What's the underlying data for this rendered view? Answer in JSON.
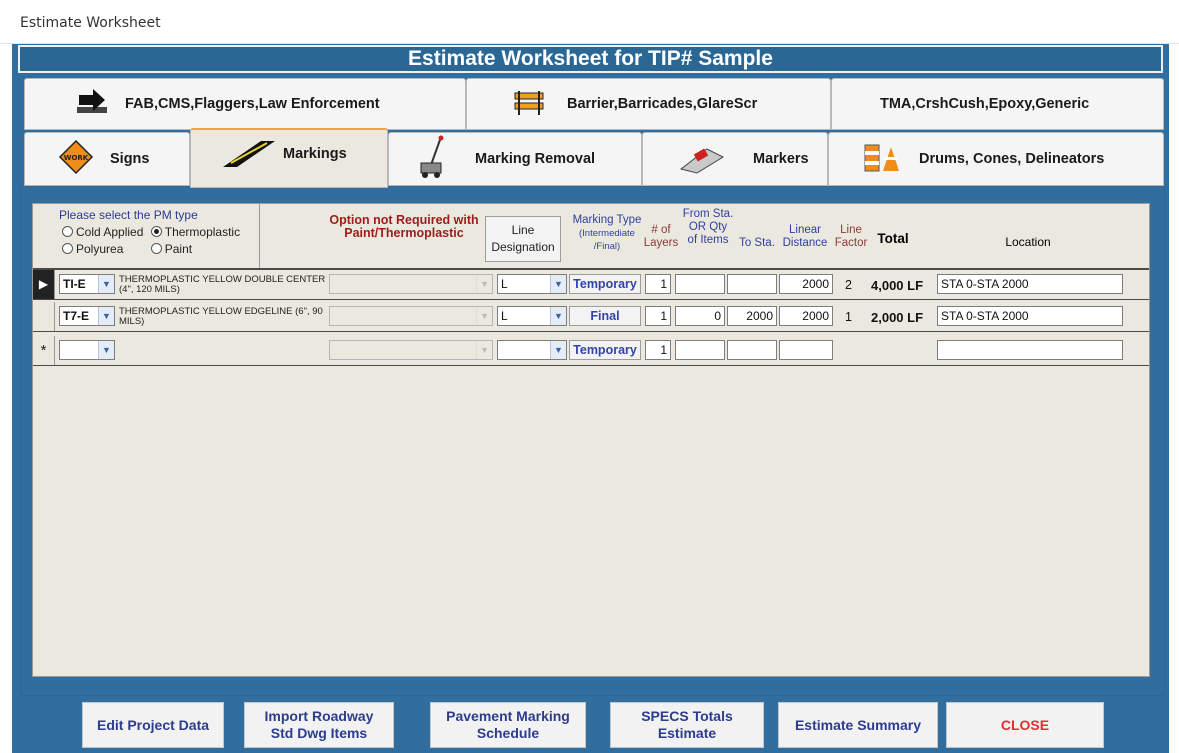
{
  "window": {
    "title": "Estimate Worksheet"
  },
  "header": {
    "title": "Estimate Worksheet for TIP# Sample"
  },
  "tabs_row1": [
    {
      "label": "FAB,CMS,Flaggers,Law Enforcement",
      "icon": "arrow-sign-icon"
    },
    {
      "label": "Barrier,Barricades,GlareScr",
      "icon": "barricade-icon"
    },
    {
      "label": "TMA,CrshCush,Epoxy,Generic",
      "icon": ""
    }
  ],
  "tabs_row2": [
    {
      "label": "Signs",
      "icon": "work-zone-sign-icon",
      "active": false
    },
    {
      "label": "Markings",
      "icon": "road-marking-icon",
      "active": true
    },
    {
      "label": "Marking Removal",
      "icon": "grinder-icon",
      "active": false
    },
    {
      "label": "Markers",
      "icon": "pavement-marker-icon",
      "active": false
    },
    {
      "label": "Drums, Cones, Delineators",
      "icon": "traffic-cone-icon",
      "active": false
    }
  ],
  "pm_type": {
    "title": "Please select the PM type",
    "options": [
      "Cold Applied",
      "Thermoplastic",
      "Polyurea",
      "Paint"
    ],
    "selected": "Thermoplastic"
  },
  "columns": {
    "option": "Option not Required with Paint/Thermoplastic",
    "line_designation": "Line Designation",
    "marking_type_1": "Marking Type",
    "marking_type_2": "(Intermediate /Final)",
    "layers_1": "# of",
    "layers_2": "Layers",
    "from_sta_1": "From Sta.",
    "from_sta_2": "OR Qty",
    "from_sta_3": "of Items",
    "to_sta": "To Sta.",
    "linear_1": "Linear",
    "linear_2": "Distance",
    "line_factor_1": "Line",
    "line_factor_2": "Factor",
    "total": "Total",
    "location": "Location"
  },
  "rows": [
    {
      "selector": "▶",
      "code": "TI-E",
      "description": "THERMOPLASTIC YELLOW DOUBLE CENTER  (4\", 120 MILS)",
      "option": "",
      "line_designation": "L",
      "marking_type": "Temporary",
      "layers": "1",
      "from_sta": "",
      "to_sta": "",
      "linear_distance": "2000",
      "line_factor": "2",
      "total": "4,000 LF",
      "location": "STA 0-STA 2000"
    },
    {
      "selector": "",
      "code": "T7-E",
      "description": "THERMOPLASTIC YELLOW EDGELINE (6\", 90 MILS)",
      "option": "",
      "line_designation": "L",
      "marking_type": "Final",
      "layers": "1",
      "from_sta": "0",
      "to_sta": "2000",
      "linear_distance": "2000",
      "line_factor": "1",
      "total": "2,000 LF",
      "location": "STA 0-STA 2000"
    },
    {
      "selector": "*",
      "code": "",
      "description": "",
      "option": "",
      "line_designation": "",
      "marking_type": "Temporary",
      "layers": "1",
      "from_sta": "",
      "to_sta": "",
      "linear_distance": "",
      "line_factor": "",
      "total": "",
      "location": ""
    }
  ],
  "footer_buttons": [
    {
      "line1": "Edit Project Data",
      "line2": ""
    },
    {
      "line1": "Import Roadway",
      "line2": "Std Dwg Items"
    },
    {
      "line1": "Pavement Marking",
      "line2": "Schedule"
    },
    {
      "line1": "SPECS Totals",
      "line2": "Estimate"
    },
    {
      "line1": "Estimate Summary",
      "line2": ""
    },
    {
      "line1": "CLOSE",
      "line2": ""
    }
  ],
  "colors": {
    "frame": "#2f6e9e",
    "panel": "#ebe9df",
    "close": "#e03030",
    "label_blue": "#2f3f9e",
    "label_red": "#9e1b1b"
  }
}
